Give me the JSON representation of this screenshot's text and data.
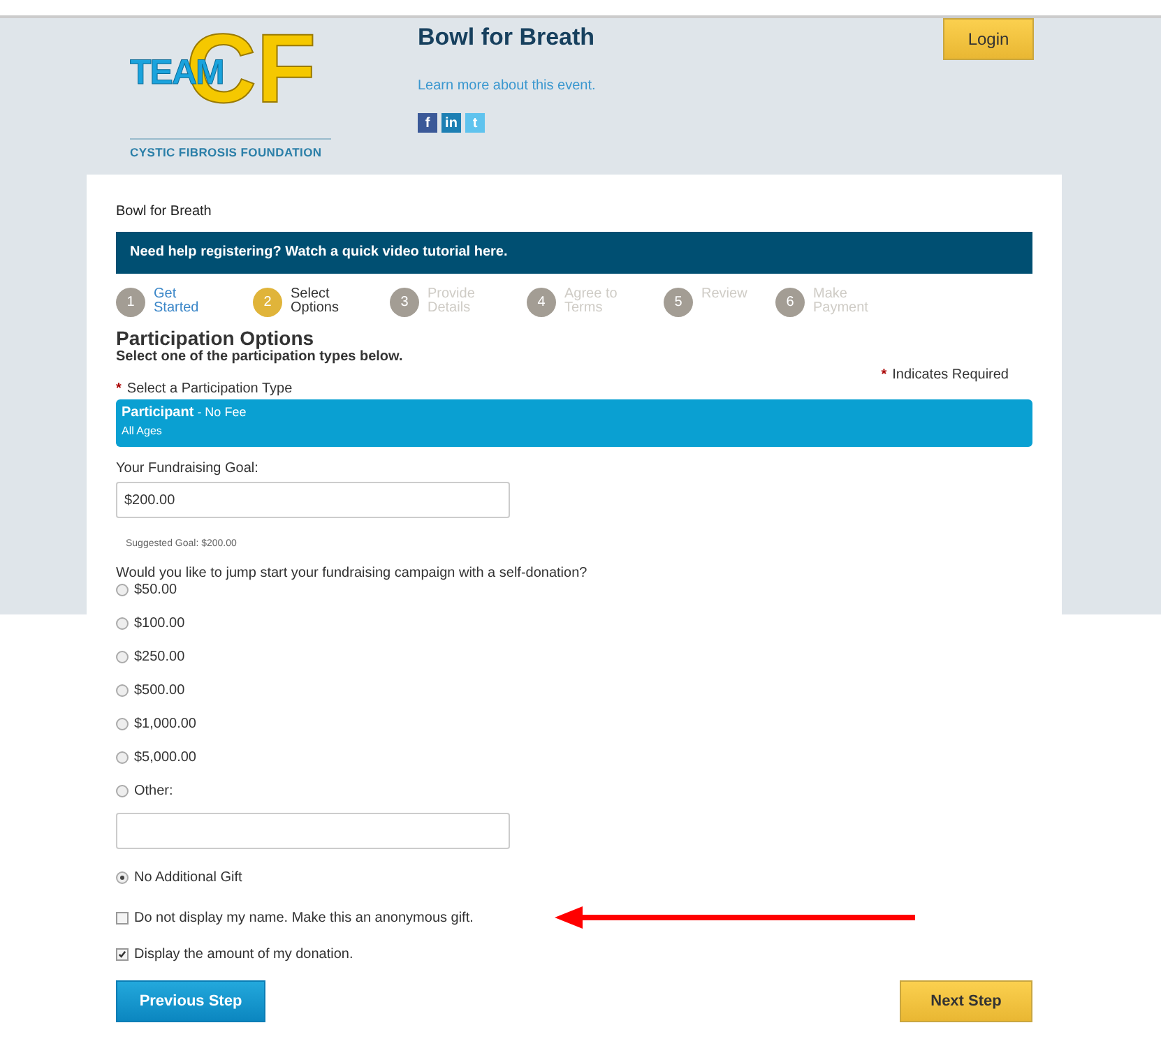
{
  "header": {
    "logo": {
      "word": "TEAM",
      "letters": "CF",
      "tagline": "CYSTIC FIBROSIS FOUNDATION"
    },
    "event_title": "Bowl for Breath",
    "event_link": "Learn more about this event.",
    "social": [
      "f",
      "in",
      "t"
    ],
    "login_button": "Login"
  },
  "breadcrumb": "Bowl for Breath",
  "help_banner": "Need help registering? Watch a quick video tutorial here.",
  "steps": [
    {
      "number": "1",
      "label": "Get Started",
      "completed": true,
      "selected": false
    },
    {
      "number": "2",
      "label": "Select Options",
      "completed": false,
      "selected": true
    },
    {
      "number": "3",
      "label": "Provide Details",
      "completed": false,
      "selected": false
    },
    {
      "number": "4",
      "label": "Agree to Terms",
      "completed": false,
      "selected": false
    },
    {
      "number": "5",
      "label": "Review",
      "completed": false,
      "selected": false
    },
    {
      "number": "6",
      "label": "Make Payment",
      "completed": false,
      "selected": false
    }
  ],
  "heading": "Participation Options",
  "subheading": "Select one of the participation types below.",
  "required_note": {
    "mark": "*",
    "text": "Indicates Required"
  },
  "type_label": {
    "mark": "*",
    "text": "Select a Participation Type"
  },
  "participation_type": {
    "name": "Participant",
    "fee": "- No Fee",
    "ages": "All Ages",
    "selected": true
  },
  "goal_label": "Your Fundraising Goal:",
  "goal_value": "$200.00",
  "suggested_goal": "Suggested Goal: $200.00",
  "donation_question": "Would you like to jump start your fundraising campaign with a self-donation?",
  "donation_options": [
    {
      "label": "$50.00",
      "selected": false
    },
    {
      "label": "$100.00",
      "selected": false
    },
    {
      "label": "$250.00",
      "selected": false
    },
    {
      "label": "$500.00",
      "selected": false
    },
    {
      "label": "$1,000.00",
      "selected": false
    },
    {
      "label": "$5,000.00",
      "selected": false
    },
    {
      "label": "Other:",
      "selected": false,
      "kind": "other"
    },
    {
      "label": "No Additional Gift",
      "selected": true
    }
  ],
  "checkboxes": [
    {
      "label": "Do not display my name. Make this an anonymous gift.",
      "checked": false,
      "annotated": true
    },
    {
      "label": "Display the amount of my donation.",
      "checked": true,
      "annotated": false
    }
  ],
  "previous_button": "Previous Step",
  "next_button": "Next Step"
}
